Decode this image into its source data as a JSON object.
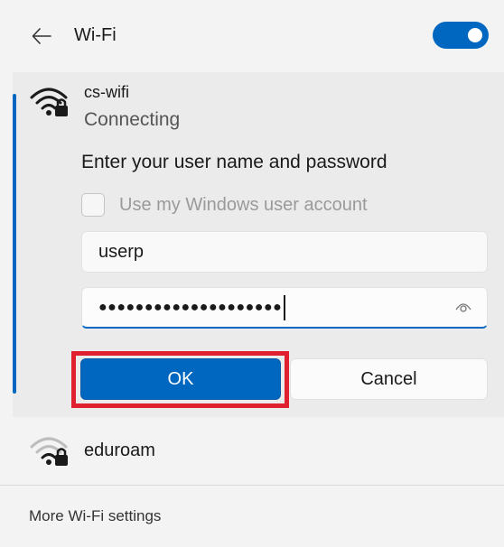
{
  "colors": {
    "accent": "#0067c0",
    "highlight": "#e0202e"
  },
  "header": {
    "back_icon": "arrow-left-icon",
    "title": "Wi-Fi",
    "toggle_on": true
  },
  "connecting_network": {
    "icon": "wifi-secured-icon",
    "name": "cs-wifi",
    "status": "Connecting",
    "prompt": "Enter your user name and password",
    "checkbox": {
      "label": "Use my Windows user account",
      "checked": false
    },
    "username_value": "userp",
    "password_masked": "●●●●●●●●●●●●●●●●●●●●",
    "reveal_icon": "eye-icon",
    "ok_label": "OK",
    "cancel_label": "Cancel"
  },
  "other_networks": [
    {
      "icon": "wifi-secured-icon",
      "name": "eduroam"
    }
  ],
  "footer": {
    "more_settings_label": "More Wi-Fi settings"
  }
}
